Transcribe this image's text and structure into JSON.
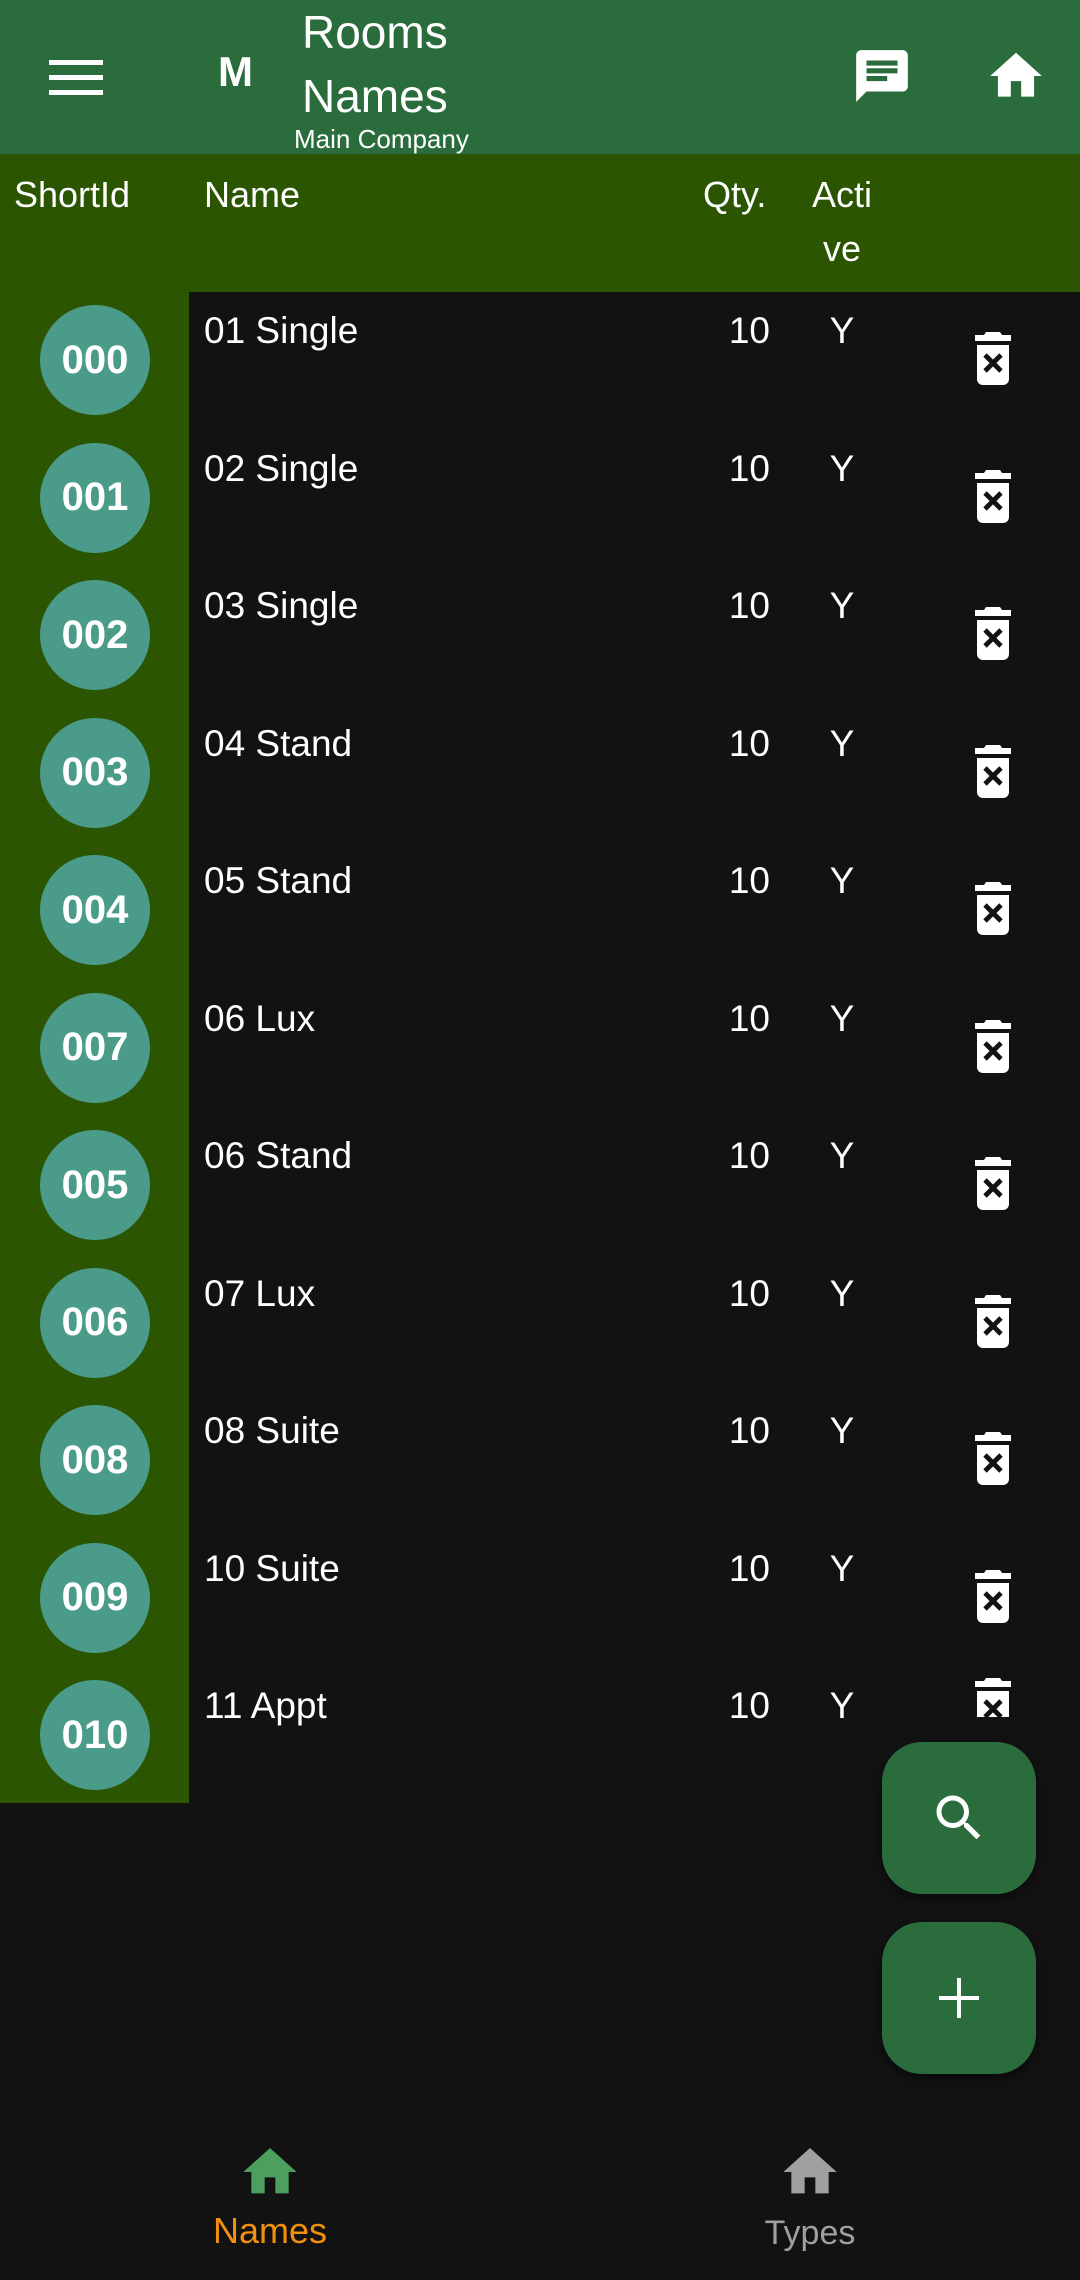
{
  "appbar": {
    "avatar_letter": "M",
    "title_line1": "Rooms",
    "title_line2": "Names",
    "subtitle": "Main Company",
    "menu_icon": "menu-icon",
    "message_icon": "message-icon",
    "home_icon": "home-icon"
  },
  "table": {
    "headers": {
      "short_id": "ShortId",
      "name": "Name",
      "qty": "Qty.",
      "active_line1": "Acti",
      "active_line2": "ve"
    },
    "rows": [
      {
        "id": "000",
        "name": "01 Single",
        "qty": "10",
        "active": "Y"
      },
      {
        "id": "001",
        "name": "02 Single",
        "qty": "10",
        "active": "Y"
      },
      {
        "id": "002",
        "name": "03 Single",
        "qty": "10",
        "active": "Y"
      },
      {
        "id": "003",
        "name": "04 Stand",
        "qty": "10",
        "active": "Y"
      },
      {
        "id": "004",
        "name": "05 Stand",
        "qty": "10",
        "active": "Y"
      },
      {
        "id": "007",
        "name": "06 Lux",
        "qty": "10",
        "active": "Y"
      },
      {
        "id": "005",
        "name": "06 Stand",
        "qty": "10",
        "active": "Y"
      },
      {
        "id": "006",
        "name": "07 Lux",
        "qty": "10",
        "active": "Y"
      },
      {
        "id": "008",
        "name": "08 Suite",
        "qty": "10",
        "active": "Y"
      },
      {
        "id": "009",
        "name": "10 Suite",
        "qty": "10",
        "active": "Y"
      },
      {
        "id": "010",
        "name": "11 Appt",
        "qty": "10",
        "active": "Y"
      }
    ]
  },
  "bottom_nav": {
    "items": [
      {
        "label": "Names",
        "icon": "home-icon",
        "active": true
      },
      {
        "label": "Types",
        "icon": "home-icon",
        "active": false
      }
    ]
  },
  "colors": {
    "appbar": "#2b6c3d",
    "header": "#2b5500",
    "badge": "#4a9b8a",
    "background": "#121212",
    "active_nav": "#f0900c",
    "active_nav_icon": "#4c9f5f"
  }
}
